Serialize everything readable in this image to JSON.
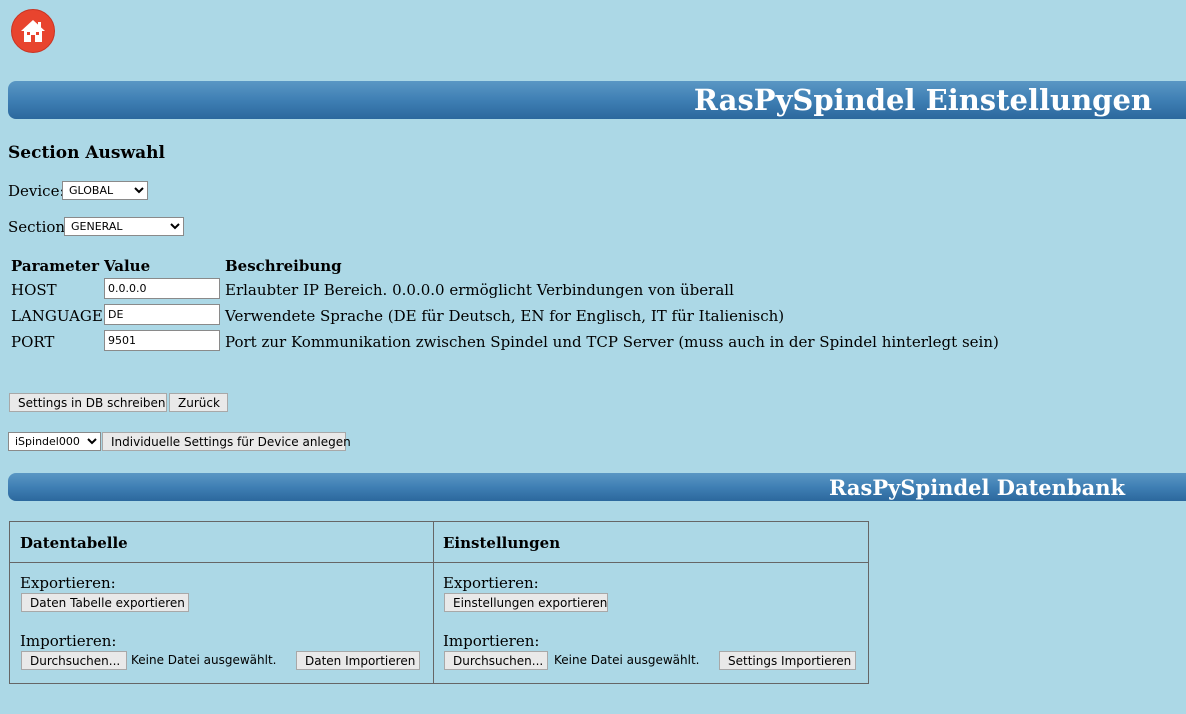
{
  "header": {
    "title": "RasPySpindel Einstellungen"
  },
  "section_select": {
    "title": "Section Auswahl",
    "device_label": "Device:",
    "device_value": "GLOBAL",
    "section_label": "Section:",
    "section_value": "GENERAL"
  },
  "params": {
    "headers": {
      "parameter": "Parameter",
      "value": "Value",
      "description": "Beschreibung"
    },
    "rows": [
      {
        "name": "HOST",
        "value": "0.0.0.0",
        "description": "Erlaubter IP Bereich. 0.0.0.0 ermöglicht Verbindungen von überall"
      },
      {
        "name": "LANGUAGE",
        "value": "DE",
        "description": "Verwendete Sprache (DE für Deutsch, EN for Englisch, IT für Italienisch)"
      },
      {
        "name": "PORT",
        "value": "9501",
        "description": "Port zur Kommunikation zwischen Spindel und TCP Server (muss auch in der Spindel hinterlegt sein)"
      }
    ]
  },
  "actions": {
    "write_label": "Settings in DB schreiben",
    "back_label": "Zurück",
    "device_select_value": "iSpindel000",
    "individual_label": "Individuelle Settings für Device anlegen"
  },
  "database": {
    "title": "RasPySpindel Datenbank",
    "left": {
      "heading": "Datentabelle",
      "export_label": "Exportieren:",
      "export_button": "Daten Tabelle exportieren",
      "import_label": "Importieren:",
      "browse_button": "Durchsuchen...",
      "no_file": "Keine Datei ausgewählt.",
      "import_button": "Daten Importieren"
    },
    "right": {
      "heading": "Einstellungen",
      "export_label": "Exportieren:",
      "export_button": "Einstellungen exportieren",
      "import_label": "Importieren:",
      "browse_button": "Durchsuchen...",
      "no_file": "Keine Datei ausgewählt.",
      "import_button": "Settings Importieren"
    }
  },
  "colors": {
    "background": "#acd8e6",
    "banner": "#3f7fb4",
    "home_button": "#e8442e"
  }
}
